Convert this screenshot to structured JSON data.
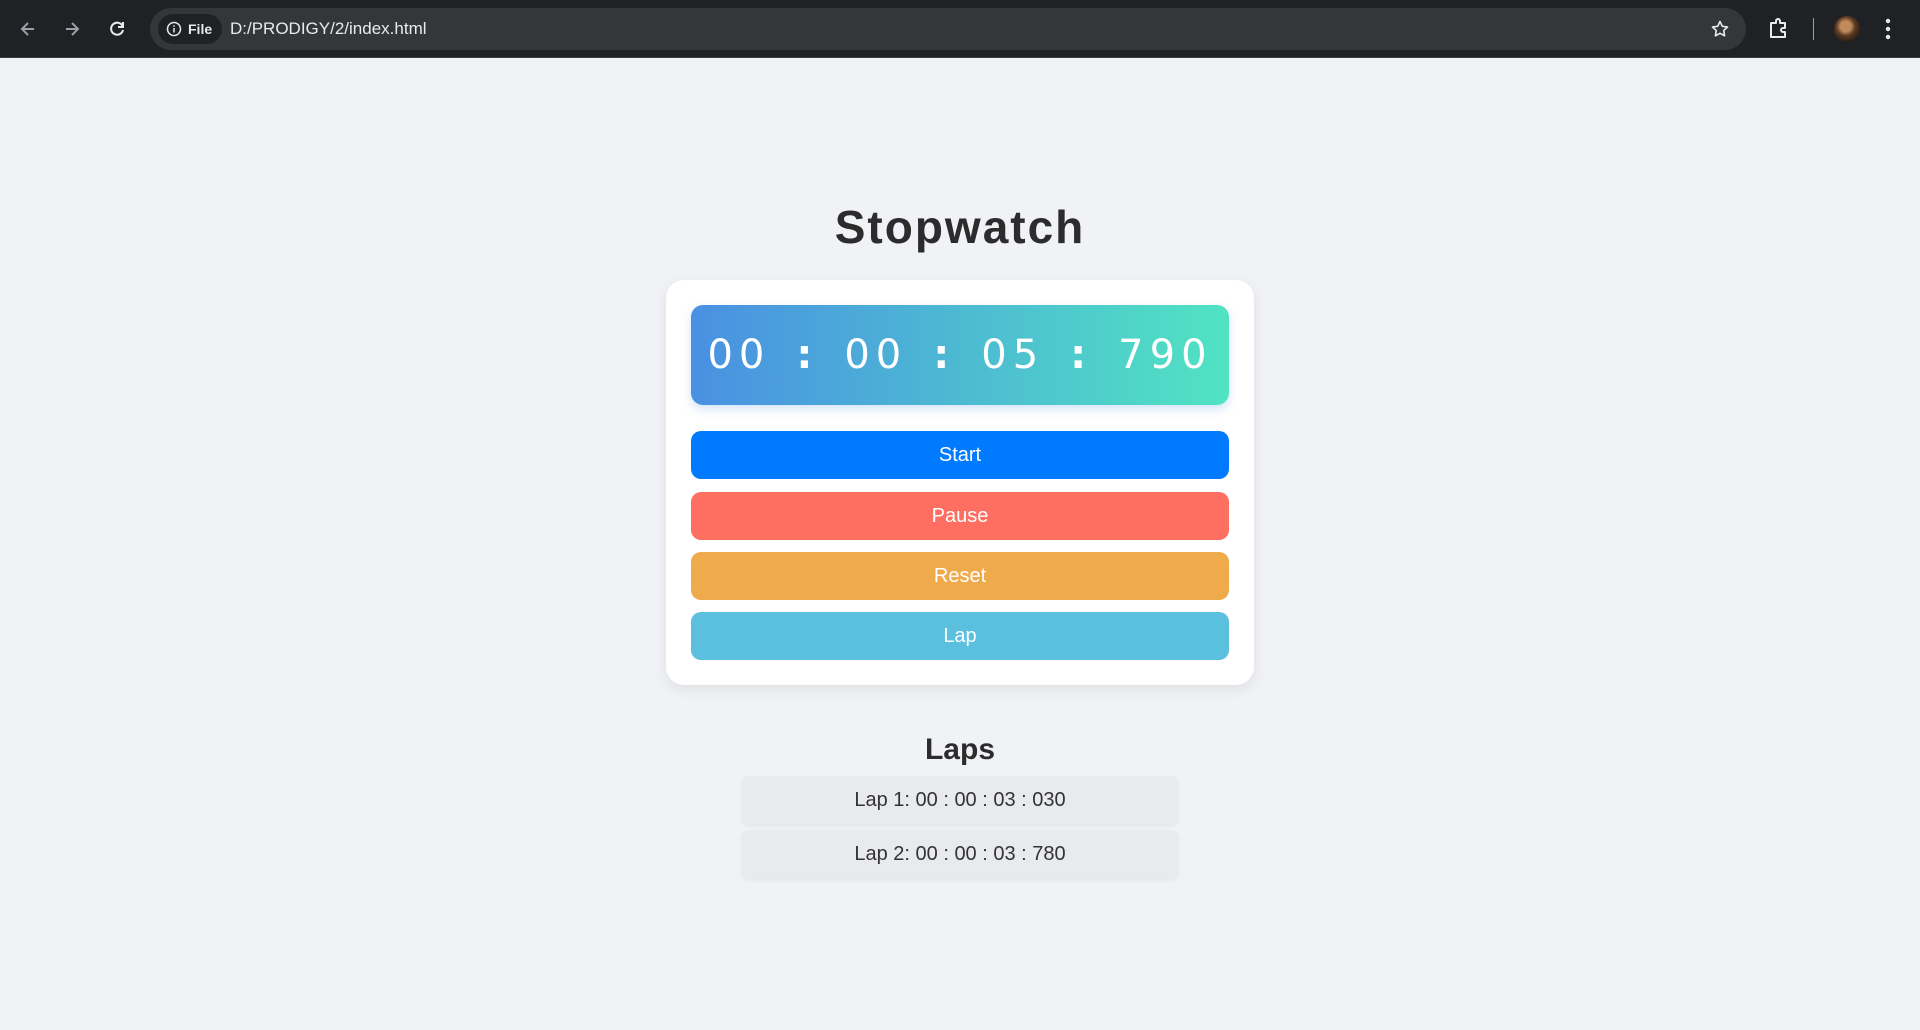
{
  "browser": {
    "site_chip_label": "File",
    "url": "D:/PRODIGY/2/index.html"
  },
  "page": {
    "title": "Stopwatch"
  },
  "stopwatch": {
    "hours": "00",
    "minutes": "00",
    "seconds": "05",
    "milliseconds": "790",
    "separator": ":"
  },
  "buttons": {
    "start": "Start",
    "pause": "Pause",
    "reset": "Reset",
    "lap": "Lap"
  },
  "laps": {
    "title": "Laps",
    "items": [
      {
        "label": "Lap 1: 00 : 00 : 03 : 030"
      },
      {
        "label": "Lap 2: 00 : 00 : 03 : 780"
      }
    ]
  },
  "colors": {
    "start": "#007bff",
    "pause": "#ff6f61",
    "reset": "#efab4b",
    "lap": "#5bc0de",
    "display_gradient_start": "#4a90e2",
    "display_gradient_end": "#50e3c2"
  },
  "icons": [
    "back-arrow-icon",
    "forward-arrow-icon",
    "reload-icon",
    "info-icon",
    "star-icon",
    "extensions-icon",
    "avatar",
    "kebab-menu-icon"
  ]
}
